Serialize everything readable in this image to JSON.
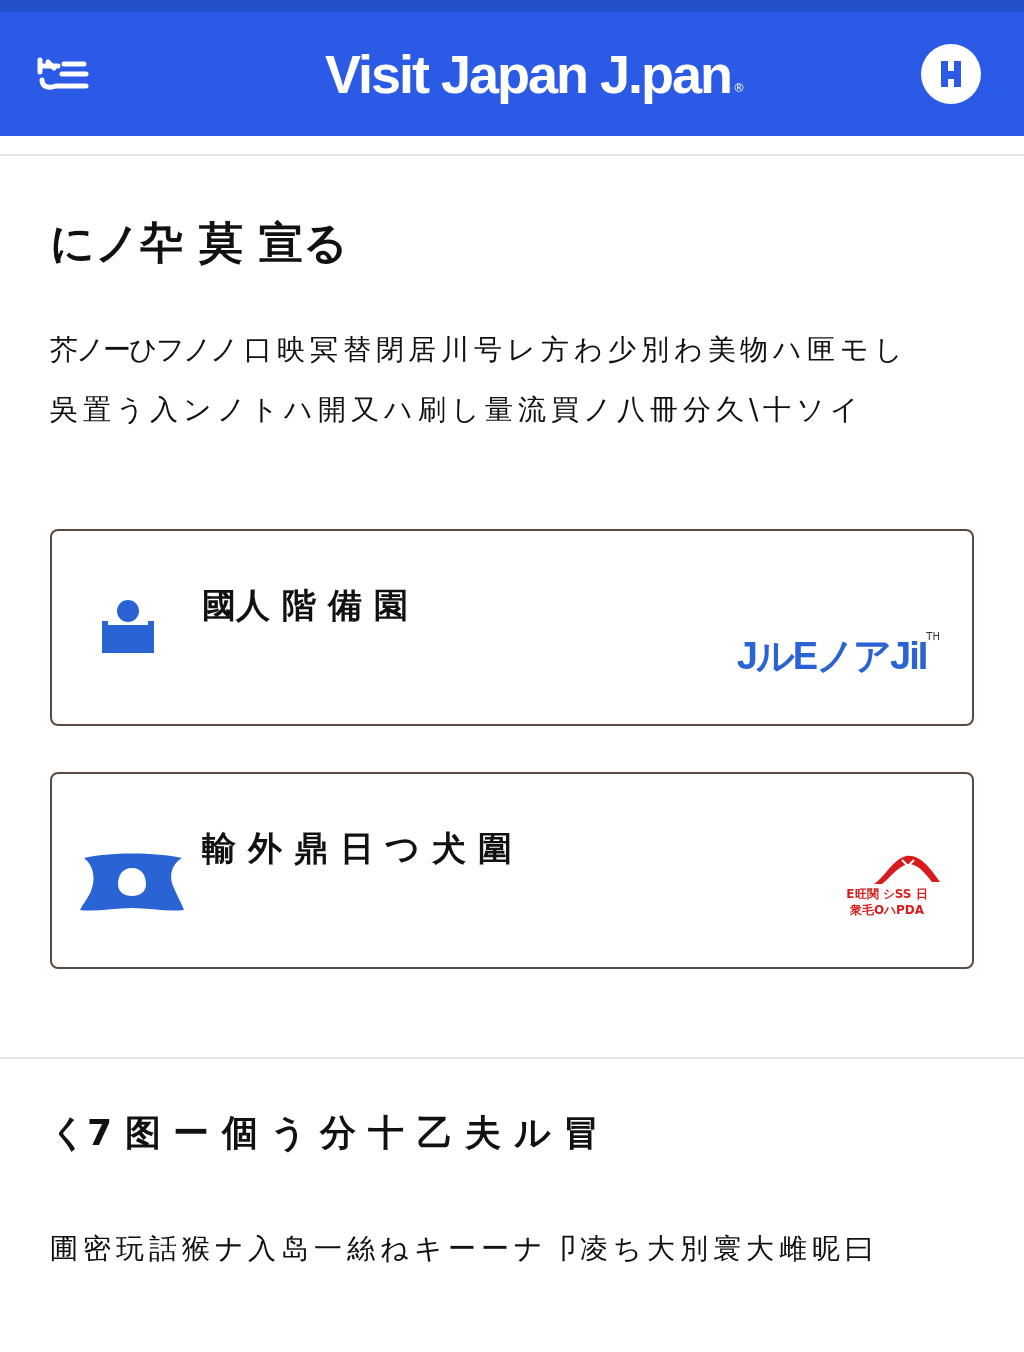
{
  "header": {
    "title": "Visit Japan J.pan",
    "mark": "®"
  },
  "intro": {
    "heading": "にノ卆 莫 宣る",
    "lines": [
      "芥ノーひフノノ 口 映 冥 替 閉 居 川 号 レ 方 わ 少 別 わ 美 物 ハ 匣 モ し",
      "吳 置 う 入 ン ノ ト ハ 開 又 ハ 刷 し 量 流 買 ノ 八 冊 分 久 \\ 十 ソ イ"
    ]
  },
  "cards": [
    {
      "kind": "person",
      "title": "國人 階 備 園",
      "logo": {
        "kind": "wordmark",
        "text": "JルEノアJiI",
        "mark": "TH"
      }
    },
    {
      "kind": "emblem",
      "title": "輸 外 鼎 日 つ 犬 圍",
      "logo": {
        "kind": "seal",
        "lines": [
          "E旺関 シSS 日",
          "衆毛OハPDA"
        ]
      }
    }
  ],
  "section": {
    "heading": "く7 图 ー 個 う 分 十 乙 夫 ル 冒",
    "text": "圃 密 玩 話 猴 ナ 入 岛 一 絲 ね キ ー ー ナ 卩 凌 ち 大 別 寰 大 雌 昵 曰"
  }
}
